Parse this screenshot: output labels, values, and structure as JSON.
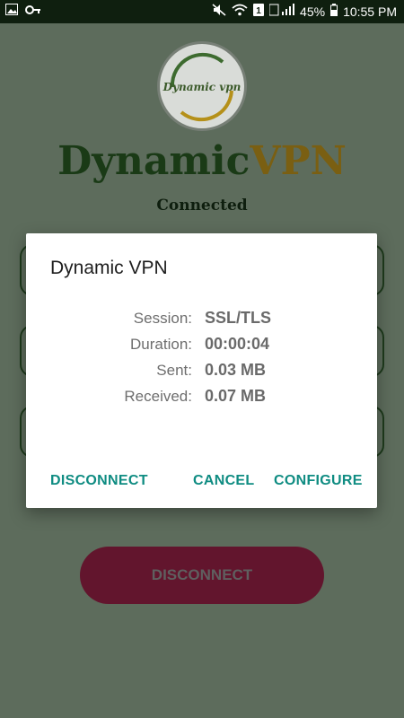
{
  "status_bar": {
    "icons_left": [
      "image-icon",
      "key-icon"
    ],
    "icons_right": [
      "mute-icon",
      "wifi-icon",
      "sim-1-icon",
      "signal-icon",
      "battery-icon"
    ],
    "battery": "45%",
    "time": "10:55 PM"
  },
  "app": {
    "logo_text": "Dynamic vpn",
    "title_part1": "Dynamic",
    "title_part2": "VPN",
    "status": "Connected",
    "disconnect_label": "DISCONNECT"
  },
  "dialog": {
    "title": "Dynamic VPN",
    "rows": [
      {
        "label": "Session:",
        "value": "SSL/TLS"
      },
      {
        "label": "Duration:",
        "value": "00:00:04"
      },
      {
        "label": "Sent:",
        "value": "0.03 MB"
      },
      {
        "label": "Received:",
        "value": "0.07 MB"
      }
    ],
    "buttons": {
      "disconnect": "DISCONNECT",
      "cancel": "CANCEL",
      "configure": "CONFIGURE"
    }
  },
  "colors": {
    "accent": "#0f8c82",
    "title_green": "#1a3a16",
    "title_gold": "#7a5f12",
    "disconnect_bg": "#62152d"
  }
}
